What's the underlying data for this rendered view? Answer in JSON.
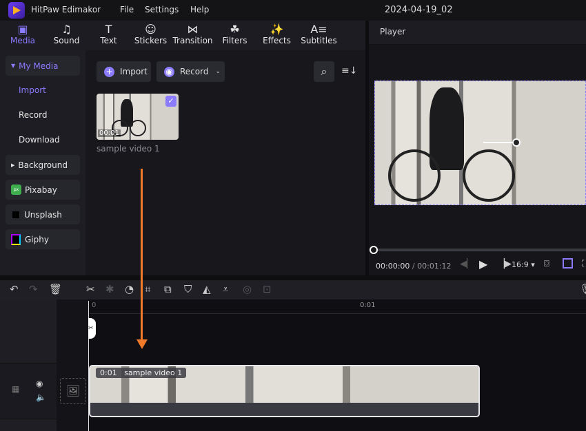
{
  "app": {
    "title": "HitPaw Edimakor",
    "menu": [
      "File",
      "Settings",
      "Help"
    ],
    "document": "2024-04-19_02"
  },
  "toolbar": [
    {
      "label": "Media",
      "icon": "media-icon",
      "active": true
    },
    {
      "label": "Sound",
      "icon": "music-note-icon"
    },
    {
      "label": "Text",
      "icon": "text-icon"
    },
    {
      "label": "Stickers",
      "icon": "smiley-icon"
    },
    {
      "label": "Transition",
      "icon": "bowtie-icon"
    },
    {
      "label": "Filters",
      "icon": "filters-icon"
    },
    {
      "label": "Effects",
      "icon": "magic-wand-icon"
    },
    {
      "label": "Subtitles",
      "icon": "subtitles-icon"
    }
  ],
  "sidebar": {
    "my_media": "My Media",
    "sub": [
      "Import",
      "Record",
      "Download"
    ],
    "background": "Background",
    "pixabay": "Pixabay",
    "unsplash": "Unsplash",
    "giphy": "Giphy"
  },
  "media": {
    "import": "Import",
    "record": "Record",
    "item": {
      "name": "sample video 1",
      "duration": "00:01",
      "selected": true
    }
  },
  "player": {
    "title": "Player",
    "current": "00:00:00",
    "sep": "/",
    "total": "00:01:12",
    "aspect": "16:9"
  },
  "timeline": {
    "ruler_start": "0",
    "ruler_mark": "0:01",
    "clip": {
      "time": "0:01",
      "name": "sample video 1"
    }
  },
  "colors": {
    "accent": "#8b7bff",
    "arrow": "#f07a2a"
  }
}
